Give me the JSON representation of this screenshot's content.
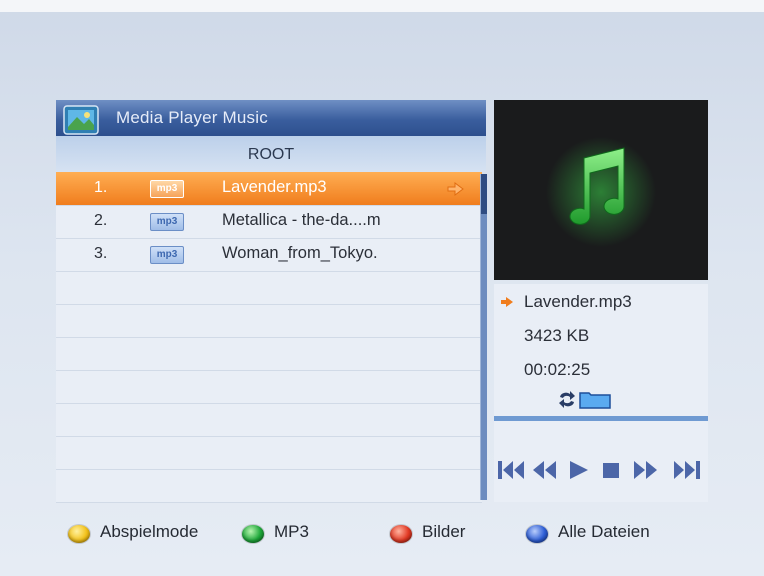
{
  "window": {
    "title": "Media Player Music"
  },
  "path": "ROOT",
  "files": [
    {
      "num": "1.",
      "type": "mp3",
      "name": "Lavender.mp3",
      "selected": true
    },
    {
      "num": "2.",
      "type": "mp3",
      "name": "Metallica - the-da....m",
      "selected": false
    },
    {
      "num": "3.",
      "type": "mp3",
      "name": "Woman_from_Tokyo.",
      "selected": false
    }
  ],
  "info": {
    "filename": "Lavender.mp3",
    "size": "3423 KB",
    "duration": "00:02:25"
  },
  "legend": [
    {
      "color": "yellow",
      "label": "Abspielmode"
    },
    {
      "color": "green",
      "label": "MP3"
    },
    {
      "color": "red",
      "label": "Bilder"
    },
    {
      "color": "blue",
      "label": "Alle Dateien"
    }
  ],
  "colors": {
    "accent": "#f07d1d",
    "header": "#3a5e9e",
    "yellow": "#f3c21b",
    "green": "#1ea83a",
    "red": "#e23a25",
    "blue": "#2f5fd6"
  },
  "icons": {
    "app": "media-app-icon",
    "preview": "music-note-icon",
    "transport": [
      "skip-back-icon",
      "rewind-icon",
      "play-icon",
      "stop-icon",
      "fast-forward-icon",
      "skip-forward-icon"
    ]
  }
}
